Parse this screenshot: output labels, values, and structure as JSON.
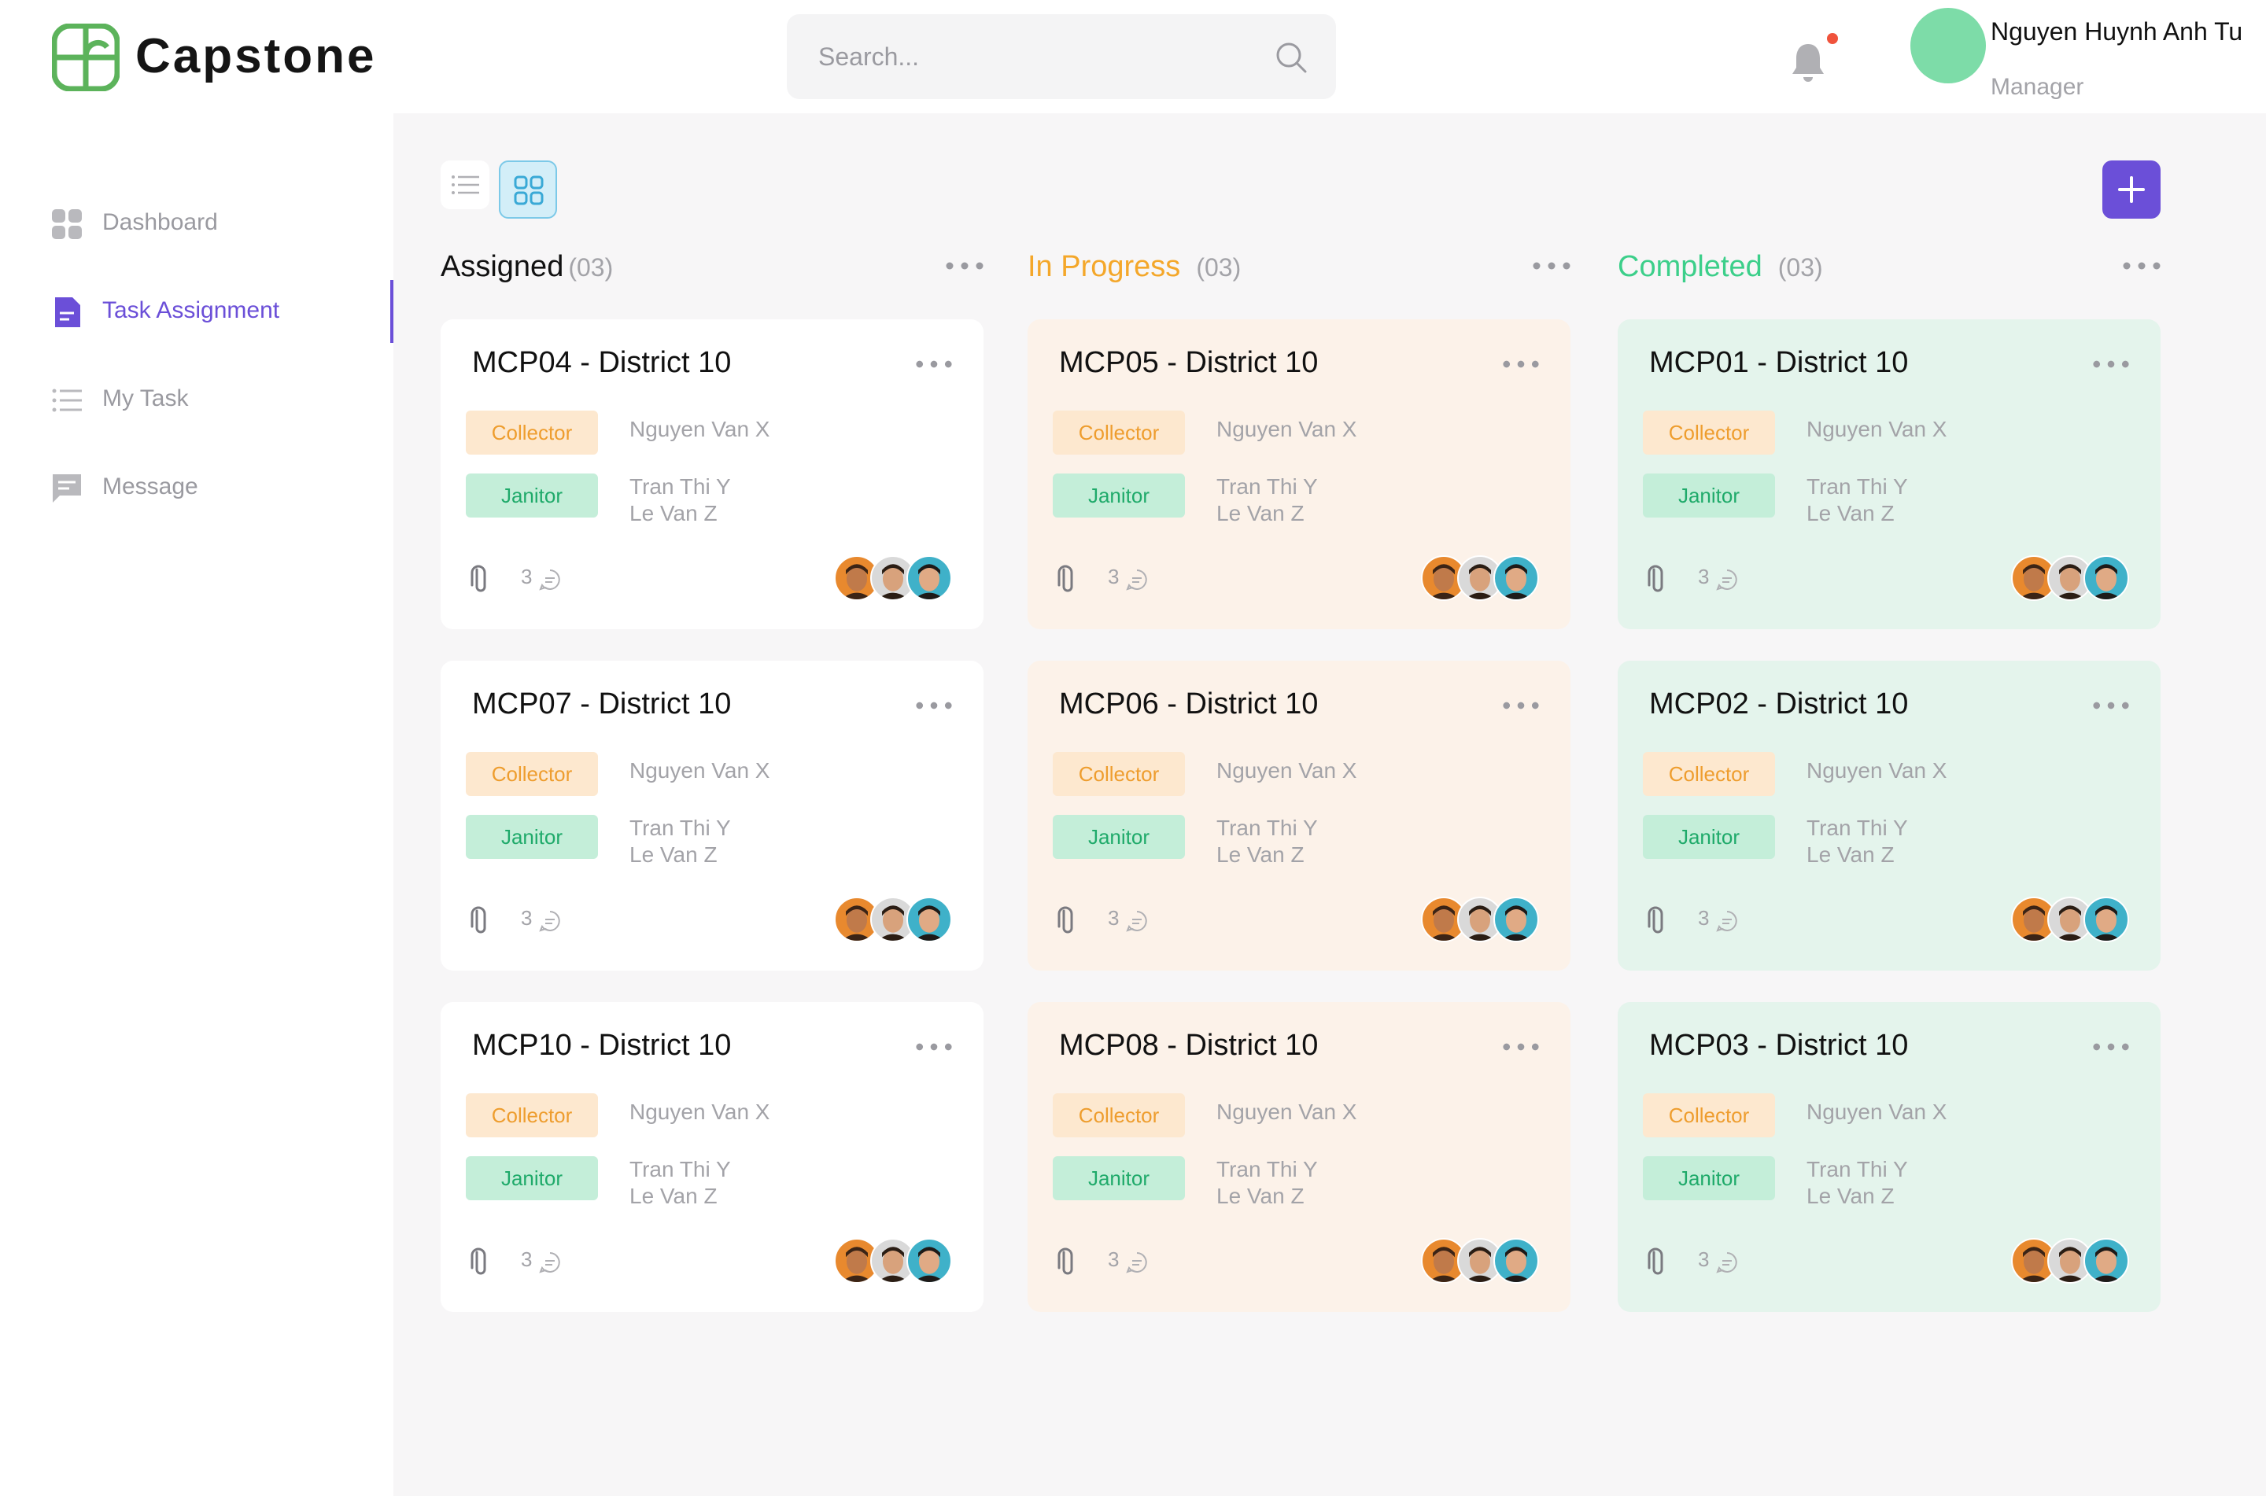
{
  "app": {
    "brand": "Capstone",
    "colors": {
      "accent": "#6b4fd8",
      "logo": "#5cb35b",
      "assigned": "#111111",
      "in_progress": "#f4a72a",
      "completed": "#3ccf8a"
    }
  },
  "header": {
    "search_placeholder": "Search...",
    "search_icon": "search-icon",
    "notification_icon": "bell-icon",
    "user": {
      "name": "Nguyen Huynh Anh Tu",
      "role": "Manager"
    }
  },
  "sidebar": {
    "items": [
      {
        "label": "Dashboard",
        "icon": "dashboard-icon",
        "active": false
      },
      {
        "label": "Task Assignment",
        "icon": "document-icon",
        "active": true
      },
      {
        "label": "My Task",
        "icon": "list-icon",
        "active": false
      },
      {
        "label": "Message",
        "icon": "message-icon",
        "active": false
      }
    ]
  },
  "toolbar": {
    "list_view_icon": "list-view-icon",
    "grid_view_icon": "grid-view-icon",
    "add_icon": "plus-icon"
  },
  "columns": [
    {
      "title": "Assigned",
      "count": "(03)",
      "color": "#111111",
      "cards": [
        {
          "title": "MCP04 - District 10",
          "collector_tag": "Collector",
          "collector": "Nguyen Van X",
          "janitor_tag": "Janitor",
          "janitor_1": "Tran Thi Y",
          "janitor_2": "Le Van Z",
          "comments": "3"
        },
        {
          "title": "MCP07 - District 10",
          "collector_tag": "Collector",
          "collector": "Nguyen Van X",
          "janitor_tag": "Janitor",
          "janitor_1": "Tran Thi Y",
          "janitor_2": "Le Van Z",
          "comments": "3"
        },
        {
          "title": "MCP10 - District 10",
          "collector_tag": "Collector",
          "collector": "Nguyen Van X",
          "janitor_tag": "Janitor",
          "janitor_1": "Tran Thi Y",
          "janitor_2": "Le Van Z",
          "comments": "3"
        }
      ]
    },
    {
      "title": "In Progress",
      "count": "(03)",
      "color": "#f4a72a",
      "cards": [
        {
          "title": "MCP05 - District 10",
          "collector_tag": "Collector",
          "collector": "Nguyen Van X",
          "janitor_tag": "Janitor",
          "janitor_1": "Tran Thi Y",
          "janitor_2": "Le Van Z",
          "comments": "3"
        },
        {
          "title": "MCP06 - District 10",
          "collector_tag": "Collector",
          "collector": "Nguyen Van X",
          "janitor_tag": "Janitor",
          "janitor_1": "Tran Thi Y",
          "janitor_2": "Le Van Z",
          "comments": "3"
        },
        {
          "title": "MCP08 - District 10",
          "collector_tag": "Collector",
          "collector": "Nguyen Van X",
          "janitor_tag": "Janitor",
          "janitor_1": "Tran Thi Y",
          "janitor_2": "Le Van Z",
          "comments": "3"
        }
      ]
    },
    {
      "title": "Completed",
      "count": "(03)",
      "color": "#3ccf8a",
      "cards": [
        {
          "title": "MCP01 - District 10",
          "collector_tag": "Collector",
          "collector": "Nguyen Van X",
          "janitor_tag": "Janitor",
          "janitor_1": "Tran Thi Y",
          "janitor_2": "Le Van Z",
          "comments": "3"
        },
        {
          "title": "MCP02 - District 10",
          "collector_tag": "Collector",
          "collector": "Nguyen Van X",
          "janitor_tag": "Janitor",
          "janitor_1": "Tran Thi Y",
          "janitor_2": "Le Van Z",
          "comments": "3"
        },
        {
          "title": "MCP03 - District 10",
          "collector_tag": "Collector",
          "collector": "Nguyen Van X",
          "janitor_tag": "Janitor",
          "janitor_1": "Tran Thi Y",
          "janitor_2": "Le Van Z",
          "comments": "3"
        }
      ]
    }
  ]
}
